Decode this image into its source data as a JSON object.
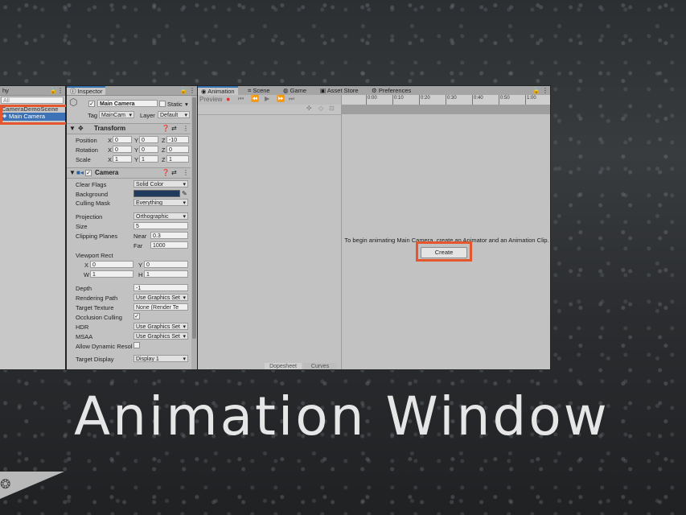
{
  "hierarchy": {
    "tab_label": "hy",
    "search_placeholder": "All",
    "scene_name": "CameraDemoScene",
    "selected_item": "Main Camera"
  },
  "inspector": {
    "tab_label": "Inspector",
    "object_name": "Main Camera",
    "static_label": "Static",
    "tag_label": "Tag",
    "tag_value": "MainCam",
    "layer_label": "Layer",
    "layer_value": "Default",
    "transform": {
      "title": "Transform",
      "position_label": "Position",
      "rotation_label": "Rotation",
      "scale_label": "Scale",
      "position": {
        "x": "0",
        "y": "0",
        "z": "-10"
      },
      "rotation": {
        "x": "0",
        "y": "0",
        "z": "0"
      },
      "scale": {
        "x": "1",
        "y": "1",
        "z": "1"
      }
    },
    "axis": {
      "x": "X",
      "y": "Y",
      "z": "Z",
      "w": "W",
      "h": "H"
    },
    "camera": {
      "title": "Camera",
      "clear_flags_label": "Clear Flags",
      "clear_flags": "Solid Color",
      "background_label": "Background",
      "background_color": "#1f3a5c",
      "culling_mask_label": "Culling Mask",
      "culling_mask": "Everything",
      "projection_label": "Projection",
      "projection": "Orthographic",
      "size_label": "Size",
      "size": "5",
      "clipping_label": "Clipping Planes",
      "near_label": "Near",
      "near": "0.3",
      "far_label": "Far",
      "far": "1000",
      "viewport_label": "Viewport Rect",
      "viewport": {
        "x": "0",
        "y": "0",
        "w": "1",
        "h": "1"
      },
      "depth_label": "Depth",
      "depth": "-1",
      "rendering_path_label": "Rendering Path",
      "rendering_path": "Use Graphics Set",
      "target_texture_label": "Target Texture",
      "target_texture": "None (Render Te",
      "occlusion_label": "Occlusion Culling",
      "hdr_label": "HDR",
      "hdr": "Use Graphics Set",
      "msaa_label": "MSAA",
      "msaa": "Use Graphics Set",
      "dynamic_res_label": "Allow Dynamic Resol",
      "target_display_label": "Target Display",
      "target_display": "Display 1"
    }
  },
  "animation": {
    "tabs": [
      "Animation",
      "Scene",
      "Game",
      "Asset Store",
      "Preferences"
    ],
    "preview_label": "Preview",
    "timeline_ticks": [
      "0:00",
      "0:10",
      "0:20",
      "0:30",
      "0:40",
      "0:50",
      "1:00"
    ],
    "message": "To begin animating Main Camera, create an Animator and an Animation Clip.",
    "create_button": "Create",
    "bottom_tabs": [
      "Dopesheet",
      "Curves"
    ]
  },
  "overlay": {
    "title": "Animation Window",
    "highlight_color": "#e4572e"
  }
}
